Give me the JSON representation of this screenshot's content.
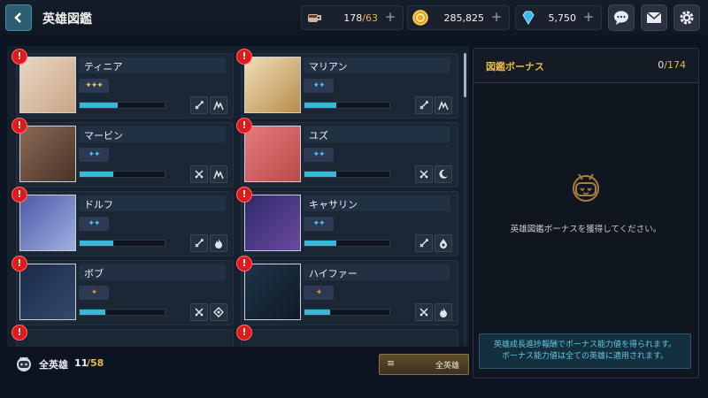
{
  "header": {
    "title": "英雄図鑑"
  },
  "resources": {
    "stamina": {
      "value": "178",
      "max": "/63"
    },
    "gold": {
      "value": "285,825"
    },
    "gems": {
      "value": "5,750"
    }
  },
  "heroes": [
    {
      "name": "ティニア",
      "stars": "✦✦✦",
      "star_color": "#f2c94c",
      "progress": 0.45,
      "icons": [
        "sword-icon",
        "mountain-icon"
      ]
    },
    {
      "name": "マリアン",
      "stars": "✦✦",
      "star_color": "#4fc3e8",
      "progress": 0.38,
      "icons": [
        "sword-icon",
        "mountain-icon"
      ]
    },
    {
      "name": "マービン",
      "stars": "✦✦",
      "star_color": "#4fc3e8",
      "progress": 0.4,
      "icons": [
        "crossed-swords-icon",
        "mountain-icon"
      ]
    },
    {
      "name": "ユズ",
      "stars": "✦✦",
      "star_color": "#4fc3e8",
      "progress": 0.38,
      "icons": [
        "crossed-swords-icon",
        "moon-icon"
      ]
    },
    {
      "name": "ドルフ",
      "stars": "✦✦",
      "star_color": "#4fc3e8",
      "progress": 0.4,
      "icons": [
        "sword-icon",
        "flame-icon"
      ]
    },
    {
      "name": "キャサリン",
      "stars": "✦✦",
      "star_color": "#4fc3e8",
      "progress": 0.38,
      "icons": [
        "sword-icon",
        "water-drop-icon"
      ]
    },
    {
      "name": "ボブ",
      "stars": "✦",
      "star_color": "#f08a3c",
      "progress": 0.3,
      "icons": [
        "crossed-swords-icon",
        "diamond-icon"
      ]
    },
    {
      "name": "ハイファー",
      "stars": "✦",
      "star_color": "#f08a3c",
      "progress": 0.3,
      "icons": [
        "crossed-swords-icon",
        "flame-icon"
      ]
    }
  ],
  "footer": {
    "label": "全英雄",
    "owned": "11",
    "total": "/58",
    "filter_label": "全英雄"
  },
  "bonus_panel": {
    "title": "図鑑ボーナス",
    "count": "0",
    "max": "/174",
    "message": "英雄図鑑ボーナスを獲得してください。",
    "note_line1": "英雄成長進捗報酬でボーナス能力値を得られます。",
    "note_line2": "ボーナス能力値は全ての英雄に適用されます。"
  },
  "colors": {
    "accent_gold": "#e5b848",
    "accent_cyan": "#38b7d6",
    "alert_red": "#e01a1a"
  }
}
